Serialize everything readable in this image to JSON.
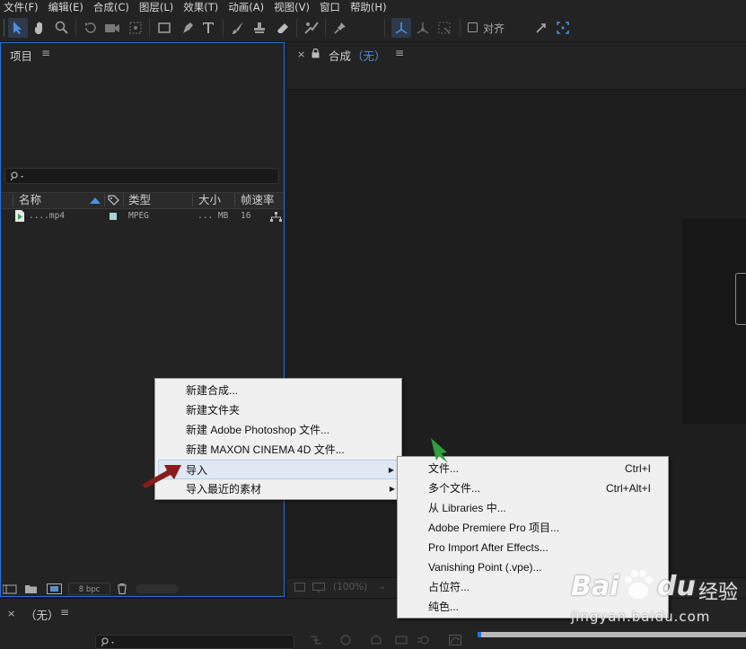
{
  "menubar": {
    "items": [
      "文件(F)",
      "编辑(E)",
      "合成(C)",
      "图层(L)",
      "效果(T)",
      "动画(A)",
      "视图(V)",
      "窗口",
      "帮助(H)"
    ]
  },
  "toolbar": {
    "align_label": "对齐",
    "align_checked": false
  },
  "project_panel": {
    "title": "项目",
    "menu_icon": "≡",
    "search_placeholder": "",
    "columns": {
      "name": "名称",
      "type": "类型",
      "size": "大小",
      "fps": "帧速率"
    },
    "files": [
      {
        "name": "....mp4",
        "type": "MPEG",
        "size": "... MB",
        "fps": "16"
      }
    ],
    "footer": {
      "bpc": "8 bpc"
    }
  },
  "composition_panel": {
    "tab_label": "合成",
    "tab_value": "（无）",
    "zoom": "(100%)"
  },
  "timeline_panel": {
    "title": "（无）"
  },
  "context_menu": {
    "items": [
      {
        "label": "新建合成..."
      },
      {
        "label": "新建文件夹"
      },
      {
        "label": "新建 Adobe Photoshop 文件..."
      },
      {
        "label": "新建 MAXON CINEMA 4D 文件..."
      },
      {
        "label": "导入",
        "submenu": true,
        "highlighted": true
      },
      {
        "label": "导入最近的素材",
        "submenu": true
      }
    ]
  },
  "import_submenu": {
    "items": [
      {
        "label": "文件...",
        "shortcut": "Ctrl+I"
      },
      {
        "label": "多个文件...",
        "shortcut": "Ctrl+Alt+I"
      },
      {
        "label": "从 Libraries 中..."
      },
      {
        "label": "Adobe Premiere Pro 项目..."
      },
      {
        "label": "Pro Import After Effects..."
      },
      {
        "label": "Vanishing Point (.vpe)..."
      },
      {
        "label": "占位符..."
      },
      {
        "label": "纯色..."
      }
    ]
  },
  "watermark": {
    "brand": "Bai",
    "brand2": "du",
    "suffix": "经验",
    "url": "jingyan.baidu.com"
  },
  "colors": {
    "panel_bg": "#232323",
    "accent_blue": "#2d6fd6",
    "menu_bg": "#f0f0f0",
    "menu_highlight": "#dfe8f3",
    "annotation_red": "#8b1a1a",
    "annotation_green": "#2e9e3e"
  }
}
